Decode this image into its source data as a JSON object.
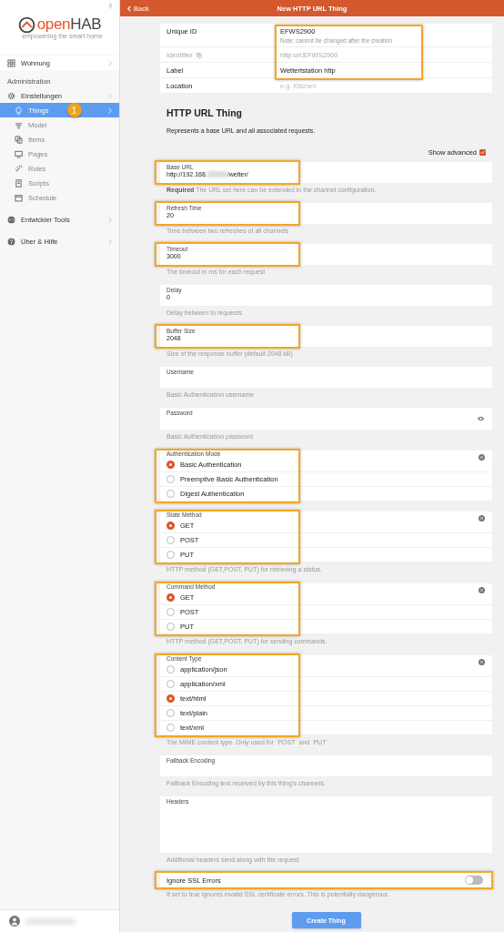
{
  "sidebar": {
    "logo": {
      "parts": [
        "open",
        "HAB"
      ],
      "tagline": "empowering the smart home"
    },
    "items": [
      {
        "label": "Wohnung",
        "selected": false
      }
    ],
    "section_title": "Administration",
    "admin_items": [
      {
        "label": "Einstellungen",
        "selected": false,
        "children": [
          {
            "label": "Things",
            "selected": true,
            "badge": "1"
          },
          {
            "label": "Model",
            "selected": false
          },
          {
            "label": "Items",
            "selected": false
          },
          {
            "label": "Pages",
            "selected": false
          },
          {
            "label": "Rules",
            "selected": false
          },
          {
            "label": "Scripts",
            "selected": false
          },
          {
            "label": "Schedule",
            "selected": false
          }
        ]
      },
      {
        "label": "Entwickler Tools",
        "selected": false
      },
      {
        "label": "Über & Hilfe",
        "selected": false
      }
    ]
  },
  "header": {
    "back": "Back",
    "title": "New HTTP URL Thing"
  },
  "info": {
    "rows": [
      {
        "label": "Unique ID",
        "value": "EFWS2900",
        "note": "Note: cannot be changed after the creation",
        "disabled": false,
        "highlighted": true
      },
      {
        "label": "Identifier",
        "value": "http:url:EFWS2900",
        "disabled": true,
        "highlighted": true
      },
      {
        "label": "Label",
        "value": "Wettertstation http",
        "disabled": false,
        "highlighted": true
      },
      {
        "label": "Location",
        "placeholder": "e.g. Kitchen",
        "disabled": false,
        "highlighted": false
      }
    ]
  },
  "section": {
    "title": "HTTP URL Thing",
    "description": "Represents a base URL and all associated requests.",
    "show_advanced": {
      "label": "Show advanced",
      "checked": true
    }
  },
  "parameters": [
    {
      "kind": "text",
      "label": "Base URL",
      "value": "http://192.168.",
      "value_after_redaction": "/wetter/",
      "hint": "**Required** The URL set here can be extended in the channel configuration.",
      "highlighted": true
    },
    {
      "kind": "text",
      "label": "Refresh Time",
      "value": "20",
      "hint": "Time between two refreshes of all channels",
      "highlighted": true
    },
    {
      "kind": "text",
      "label": "Timeout",
      "value": "3000",
      "hint": "The timeout in ms for each request",
      "highlighted": true
    },
    {
      "kind": "text",
      "label": "Delay",
      "value": "0",
      "hint": "Delay between to requests",
      "highlighted": false
    },
    {
      "kind": "text",
      "label": "Buffer Size",
      "value": "2048",
      "hint": "Size of the response buffer (default 2048 kB)",
      "highlighted": true
    },
    {
      "kind": "text",
      "label": "Username",
      "hint": "Basic Authentication username",
      "highlighted": false
    },
    {
      "kind": "password",
      "label": "Password",
      "hint": "Basic Authentication password",
      "highlighted": false
    },
    {
      "kind": "radio",
      "label": "Authentication Mode",
      "highlighted": true,
      "options": [
        {
          "label": "Basic Authentication",
          "selected": true
        },
        {
          "label": "Preemptive Basic Authentication",
          "selected": false
        },
        {
          "label": "Digest Authentication",
          "selected": false
        }
      ]
    },
    {
      "kind": "radio",
      "label": "State Method",
      "hint": "HTTP method (GET,POST, PUT) for retrieving a status.",
      "highlighted": true,
      "options": [
        {
          "label": "GET",
          "selected": true
        },
        {
          "label": "POST",
          "selected": false
        },
        {
          "label": "PUT",
          "selected": false
        }
      ]
    },
    {
      "kind": "radio",
      "label": "Command Method",
      "hint": "HTTP method (GET,POST, PUT) for sending commands.",
      "highlighted": true,
      "options": [
        {
          "label": "GET",
          "selected": true
        },
        {
          "label": "POST",
          "selected": false
        },
        {
          "label": "PUT",
          "selected": false
        }
      ]
    },
    {
      "kind": "radio",
      "label": "Content Type",
      "hint": "The MIME content type. Only used for `POST` and `PUT`.",
      "highlighted": true,
      "options": [
        {
          "label": "application/json",
          "selected": false
        },
        {
          "label": "application/xml",
          "selected": false
        },
        {
          "label": "text/html",
          "selected": true
        },
        {
          "label": "text/plain",
          "selected": false
        },
        {
          "label": "text/xml",
          "selected": false
        }
      ]
    },
    {
      "kind": "text",
      "label": "Fallback Encoding",
      "hint": "Fallback Encoding text received by this thing's channels.",
      "highlighted": false
    },
    {
      "kind": "textarea",
      "label": "Headers",
      "hint": "Additional headers send along with the request",
      "highlighted": false
    },
    {
      "kind": "toggle",
      "label": "Ignore SSL Errors",
      "on": false,
      "hint": "If set to true ignores invalid SSL certificate errors. This is potentially dangerous.",
      "highlighted": true
    }
  ],
  "create_button": "Create Thing"
}
